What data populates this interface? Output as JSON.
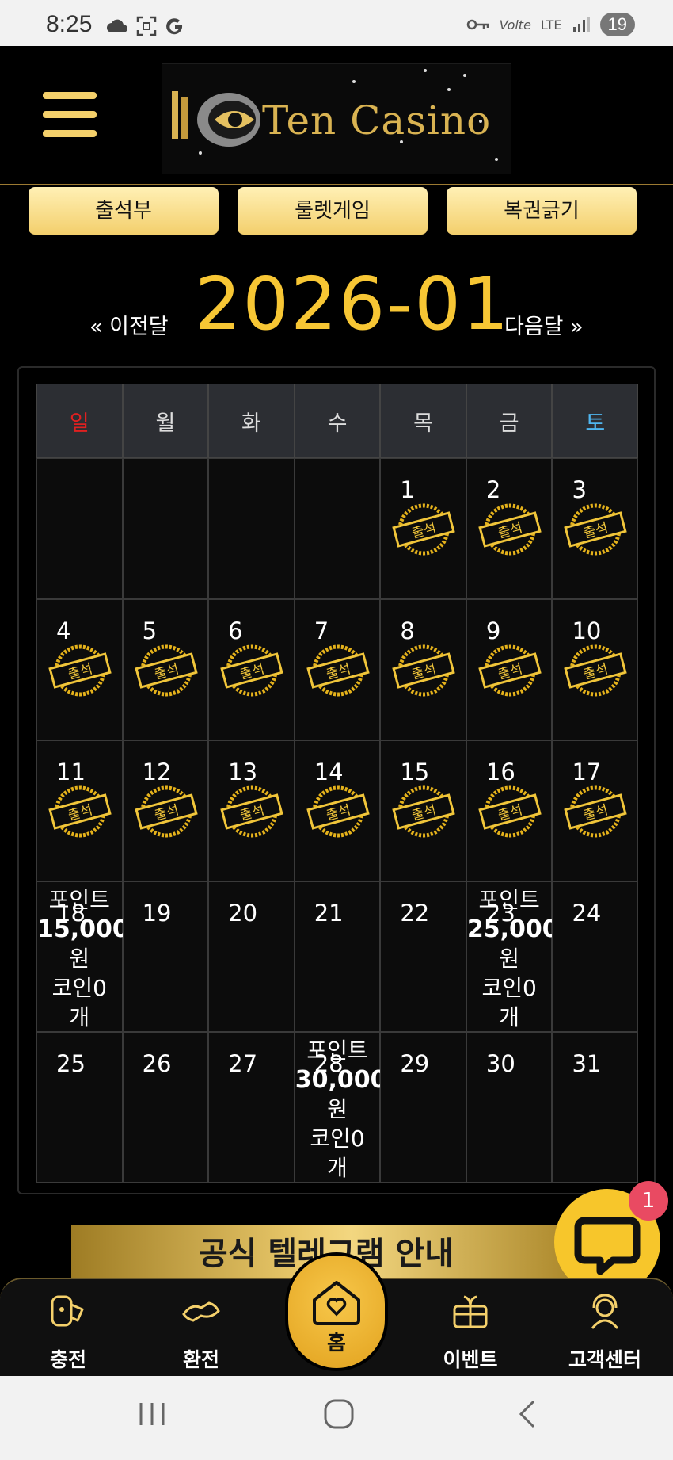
{
  "status_bar": {
    "time": "8:25",
    "network": "LTE",
    "volte": "Volte",
    "battery": "19"
  },
  "header": {
    "logo_text": "Ten Casino"
  },
  "top_buttons": [
    "출석부",
    "룰렛게임",
    "복권긁기"
  ],
  "month_nav": {
    "prev": "« 이전달",
    "title": "2026-01",
    "next": "다음달 »"
  },
  "calendar": {
    "weekdays": [
      "일",
      "월",
      "화",
      "수",
      "목",
      "금",
      "토"
    ],
    "stamp_label": "출석",
    "stamped_days": [
      "1",
      "2",
      "3",
      "4",
      "5",
      "6",
      "7",
      "8",
      "9",
      "10",
      "11",
      "12",
      "13",
      "14",
      "15",
      "16",
      "17"
    ],
    "weeks": [
      [
        "",
        "",
        "",
        "",
        "1",
        "2",
        "3"
      ],
      [
        "4",
        "5",
        "6",
        "7",
        "8",
        "9",
        "10"
      ],
      [
        "11",
        "12",
        "13",
        "14",
        "15",
        "16",
        "17"
      ],
      [
        "18",
        "19",
        "20",
        "21",
        "22",
        "23",
        "24"
      ],
      [
        "25",
        "26",
        "27",
        "28",
        "29",
        "30",
        "31"
      ]
    ],
    "rewards": {
      "18": {
        "line1": "포인트",
        "amount": "15,000",
        "line3": "원",
        "line4": "코인0",
        "line5": "개"
      },
      "23": {
        "line1": "포인트",
        "amount": "25,000",
        "line3": "원",
        "line4": "코인0",
        "line5": "개"
      },
      "28": {
        "line1": "포인트",
        "amount": "30,000",
        "line3": "원",
        "line4": "코인0",
        "line5": "개"
      }
    }
  },
  "banner": {
    "text": "공식 텔레그램 안내"
  },
  "chat": {
    "badge": "1"
  },
  "bottom_nav": {
    "charge": "충전",
    "exchange": "환전",
    "home": "홈",
    "event": "이벤트",
    "support": "고객센터"
  },
  "colors": {
    "accent": "#f7c634",
    "button_gold": "#f3cf6c",
    "sunday": "#e02020",
    "saturday": "#4fb6f0",
    "badge": "#e94a62"
  }
}
